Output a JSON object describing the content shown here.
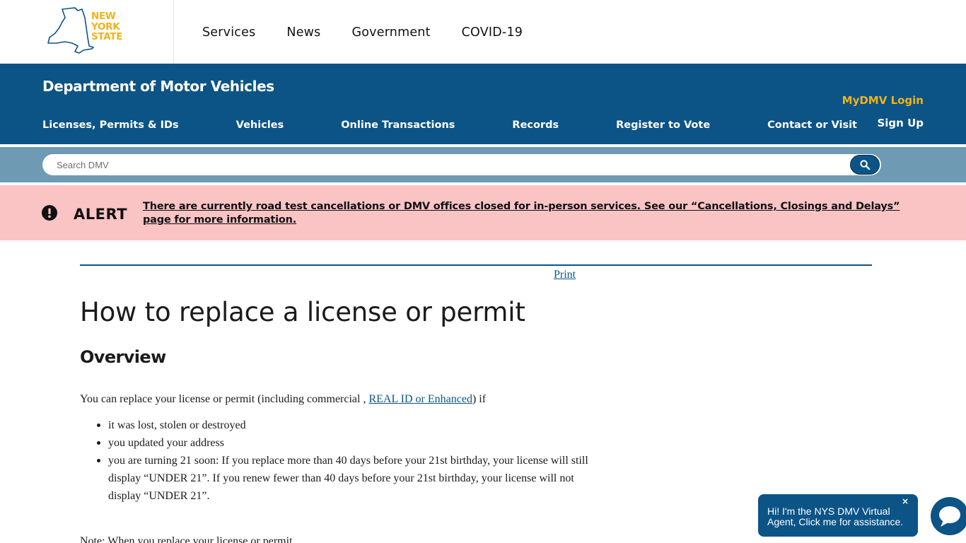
{
  "nys": {
    "logo_lines": [
      "NEW",
      "YORK",
      "STATE"
    ],
    "nav": [
      "Services",
      "News",
      "Government",
      "COVID-19"
    ]
  },
  "dmv": {
    "title": "Department of Motor Vehicles",
    "mydmv_login": "MyDMV Login",
    "sign_up": "Sign Up",
    "nav": [
      "Licenses, Permits & IDs",
      "Vehicles",
      "Online Transactions",
      "Records",
      "Register to Vote",
      "Contact or Visit"
    ]
  },
  "search": {
    "placeholder": "Search DMV",
    "button_icon": "search-icon"
  },
  "alert": {
    "label": "ALERT",
    "icon": "exclamation-circle-icon",
    "text": "There are currently road test cancellations or DMV offices closed for in-person services. See our “Cancellations, Closings and Delays” page for more information."
  },
  "content": {
    "print_label": "Print",
    "title": "How to replace a license or permit",
    "section_heading": "Overview",
    "intro_before": "You can replace your license or permit (including commercial , ",
    "intro_link": "REAL ID or Enhanced",
    "intro_after": ") if",
    "bullets": [
      "it was lost, stolen or destroyed",
      "you updated your address",
      "you are turning 21 soon: If you replace more than 40 days before your 21st birthday, your license will still display “UNDER 21”. If you renew fewer than 40 days before your 21st birthday, your license will not display “UNDER 21”."
    ],
    "note_partial": "Note: When you replace your license or permit"
  },
  "chat": {
    "message": "Hi! I'm the NYS DMV Virtual Agent, Click me for assistance.",
    "close_label": "×",
    "launcher_icon": "chat-icon"
  },
  "colors": {
    "dmv_blue": "#0c5486",
    "search_band": "#6e9ab3",
    "alert_bg": "#fbc4c4",
    "nys_gold": "#f2b21b"
  }
}
